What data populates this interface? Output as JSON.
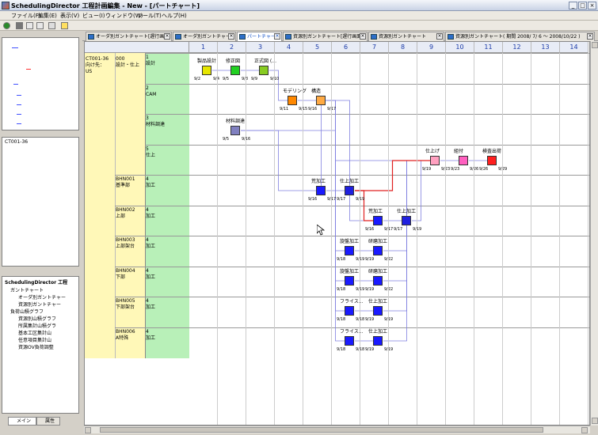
{
  "window": {
    "title": "SchedulingDirector 工程計画編集 - New - [パートチャート]",
    "min": "_",
    "max": "□",
    "close": "×"
  },
  "menu": [
    "ファイル(F)",
    "編集(E)",
    "表示(V)",
    "ビュー(I)",
    "ウィンドウ(W)",
    "ツール(T)",
    "ヘルプ(H)"
  ],
  "tabs": [
    {
      "label": "オーダ別ガントチャート[遅行画面]",
      "active": false
    },
    {
      "label": "オーダ別ガントチャート",
      "active": false
    },
    {
      "label": "パートチャート",
      "active": true
    },
    {
      "label": "資源別ガントチャート[遅行画面]",
      "active": false
    },
    {
      "label": "資源別ガントチャート",
      "active": false
    },
    {
      "label": "資源別ガントチャート( 期間 2008/ 7/ 6 〜 2008/10/22 )",
      "active": false
    }
  ],
  "left": {
    "tree_top": "CT001-36",
    "project_root": "SchedulingDirector 工程",
    "items": [
      "ガントチャート",
      "オーダ別ガントチャー",
      "資源別ガントチャー",
      "負荷山積グラフ",
      "資源別山積グラフ",
      "所属集計山積グラ",
      "基本工区集計山",
      "任意項目集計山",
      "資源OV負荷調整"
    ],
    "tab_main": "メイン",
    "tab_attr": "属性"
  },
  "grid": {
    "columns": [
      "1",
      "2",
      "3",
      "4",
      "5",
      "6",
      "7",
      "8",
      "9",
      "10",
      "11",
      "12",
      "13",
      "14"
    ],
    "order": "CT001-36\n向け先：\nUS",
    "item": "000\n設計・仕上",
    "rows": [
      {
        "part": "",
        "proc": "1\n設計"
      },
      {
        "part": "",
        "proc": "2\nCAM"
      },
      {
        "part": "",
        "proc": "3\n材料調達"
      },
      {
        "part": "",
        "proc": "5\n仕上"
      },
      {
        "part": "BHN001\n基準部",
        "proc": "4\n加工"
      },
      {
        "part": "BHN002\n上部",
        "proc": "4\n加工"
      },
      {
        "part": "BHN003\n上部架台",
        "proc": "4\n加工"
      },
      {
        "part": "BHN004\n下部",
        "proc": "4\n加工"
      },
      {
        "part": "BHN005\n下部架台",
        "proc": "4\n加工"
      },
      {
        "part": "BHN006\nA特殊",
        "proc": "4\n加工"
      }
    ]
  },
  "nodes": [
    {
      "label": "製品設計",
      "start": "9/2",
      "end": "9/4",
      "color": "#e6e600"
    },
    {
      "label": "修正図",
      "start": "9/5",
      "end": "9/8",
      "color": "#22d022"
    },
    {
      "label": "正式図 (...",
      "start": "9/9",
      "end": "9/10",
      "color": "#88cc22"
    },
    {
      "label": "モデリング",
      "start": "9/11",
      "end": "9/15",
      "color": "#ff8800"
    },
    {
      "label": "構造",
      "start": "9/16",
      "end": "9/17",
      "color": "#ffaa44"
    },
    {
      "label": "材料調達",
      "start": "9/5",
      "end": "9/16",
      "color": "#8080c0"
    },
    {
      "label": "仕上げ",
      "start": "9/19",
      "end": "9/23",
      "color": "#ffa0c0"
    },
    {
      "label": "組付",
      "start": "9/23",
      "end": "9/26",
      "color": "#ff60c0"
    },
    {
      "label": "検査出荷",
      "start": "9/26",
      "end": "9/29",
      "color": "#ff2020"
    },
    {
      "label": "荒加工",
      "start": "9/16",
      "end": "9/17",
      "color": "#1a1aff"
    },
    {
      "label": "仕上加工",
      "start": "9/17",
      "end": "9/19",
      "color": "#2020e0"
    },
    {
      "label": "荒加工",
      "start": "9/16",
      "end": "9/17",
      "color": "#1a1aff"
    },
    {
      "label": "仕上加工",
      "start": "9/17",
      "end": "9/19",
      "color": "#2020e0"
    },
    {
      "label": "旋盤加工",
      "start": "9/18",
      "end": "9/19",
      "color": "#1a1aff"
    },
    {
      "label": "研磨加工",
      "start": "9/19",
      "end": "9/22",
      "color": "#1a1aff"
    },
    {
      "label": "旋盤加工",
      "start": "9/18",
      "end": "9/19",
      "color": "#1a1aff"
    },
    {
      "label": "研磨加工",
      "start": "9/19",
      "end": "9/22",
      "color": "#1a1aff"
    },
    {
      "label": "フライス...",
      "start": "9/18",
      "end": "9/18",
      "color": "#1a1aff"
    },
    {
      "label": "仕上加工",
      "start": "9/19",
      "end": "9/19",
      "color": "#1a1aff"
    },
    {
      "label": "フライス...",
      "start": "9/18",
      "end": "9/18",
      "color": "#1a1aff"
    },
    {
      "label": "仕上加工",
      "start": "9/19",
      "end": "9/19",
      "color": "#1a1aff"
    }
  ]
}
